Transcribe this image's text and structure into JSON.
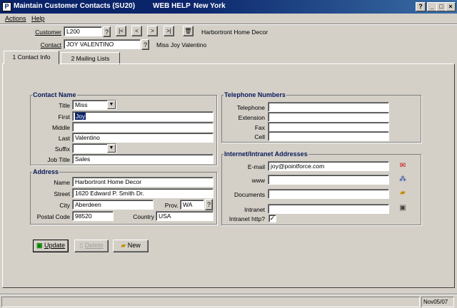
{
  "window": {
    "title": "Maintain Customer Contacts (SU20)",
    "help_label": "WEB HELP",
    "location": "New York",
    "controls": {
      "help": "?",
      "minimize": "_",
      "maximize": "□",
      "close": "×"
    },
    "app_icon": "P"
  },
  "menu": {
    "actions": "Actions",
    "help": "Help"
  },
  "header": {
    "customer_label": "Customer",
    "customer_value": "L200",
    "lookup": "?",
    "customer_name": "Harbortront Home Decor",
    "contact_label": "Contact",
    "contact_value": "JOY VALENTINO",
    "contact_name": "Miss Joy Valentino",
    "nav": {
      "first": "|<",
      "prev": "<",
      "next": ">",
      "last": ">|",
      "delete": "🗑"
    }
  },
  "tabs": [
    {
      "label": "1 Contact Info"
    },
    {
      "label": "2 Mailing Lists"
    }
  ],
  "contact_name_group": {
    "title": "Contact Name",
    "title_label": "Title",
    "title_value": "Miss",
    "first_label": "First",
    "first_value": "Joy",
    "middle_label": "Middle",
    "middle_value": "",
    "last_label": "Last",
    "last_value": "Valentino",
    "suffix_label": "Suffix",
    "suffix_value": "",
    "job_title_label": "Job Title",
    "job_title_value": "Sales"
  },
  "address_group": {
    "title": "Address",
    "name_label": "Name",
    "name_value": "Harbortront Home Decor",
    "street_label": "Street",
    "street_value": "1620 Edward P. Smith Dr.",
    "city_label": "City",
    "city_value": "Aberdeen",
    "prov_label": "Prov.",
    "prov_value": "WA",
    "postal_label": "Postal Code",
    "postal_value": "98520",
    "country_label": "Country",
    "country_value": "USA"
  },
  "telephone_group": {
    "title": "Telephone Numbers",
    "telephone_label": "Telephone",
    "telephone_value": "",
    "extension_label": "Extension",
    "extension_value": "",
    "fax_label": "Fax",
    "fax_value": "",
    "cell_label": "Cell",
    "cell_value": ""
  },
  "internet_group": {
    "title": "Internet/Intranet Addresses",
    "email_label": "E-mail",
    "email_value": "joy@pointforce.com",
    "www_label": "www",
    "www_value": "",
    "documents_label": "Documents",
    "documents_value": "",
    "intranet_label": "Intranet",
    "intranet_value": "",
    "intranet_http_label": "Intranet http?",
    "intranet_http_checked": "✓"
  },
  "actions": {
    "update": "Update",
    "delete": "Delete",
    "new": "New"
  },
  "status": {
    "date": "Nov05/07"
  }
}
